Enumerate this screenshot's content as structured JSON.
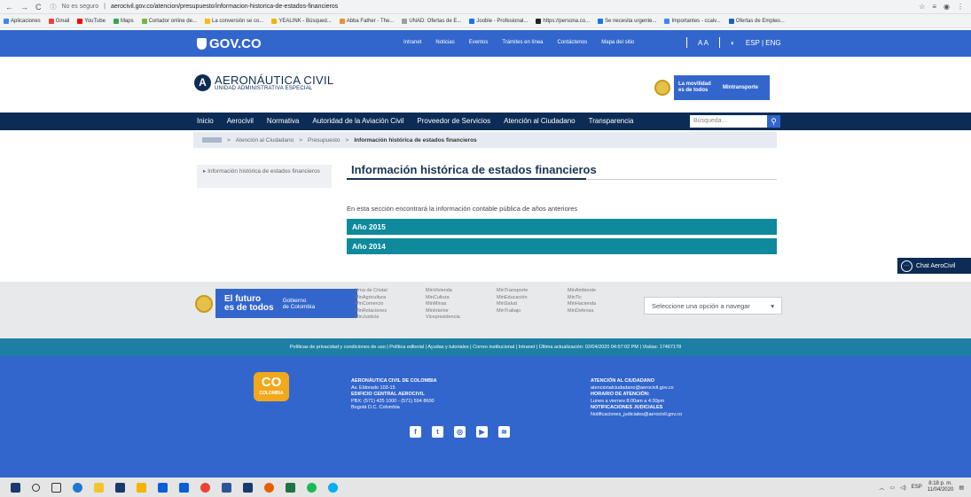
{
  "browser": {
    "security": "No es seguro",
    "url": "aerocivil.gov.co/atencion/presupuesto/informacion-historica-de-estados-financieros",
    "bookmarks": [
      "Aplicaciones",
      "Gmail",
      "YouTube",
      "Maps",
      "Cortador online de...",
      "La conversión se co...",
      "YEALINK - Búsqued...",
      "Abba Father - The...",
      "UNAD: Ofertas de E...",
      "Jooble - Profesional...",
      "https://persona.co...",
      "Se necesita urgente...",
      "Importantes - ccalv...",
      "Ofertas de Empleo..."
    ]
  },
  "gov": {
    "logo": "GOV.CO",
    "menu": [
      "Intranet",
      "Noticias",
      "Eventos",
      "Trámites en línea",
      "Contáctenos",
      "Mapa del sitio"
    ],
    "text_size": "A A",
    "language": "ESP | ENG"
  },
  "header": {
    "title": "AERONÁUTICA CIVIL",
    "subtitle": "UNIDAD ADMINISTRATIVA ESPECIAL",
    "movilidad": "La movilidad es de todos",
    "mintransporte": "Mintransporte"
  },
  "nav": {
    "items": [
      "Inicio",
      "Aerocivil",
      "Normativa",
      "Autoridad de la Aviación Civil",
      "Proveedor de Servicios",
      "Atención al Ciudadano",
      "Transparencia"
    ],
    "search_placeholder": "Búsqueda..."
  },
  "breadcrumb": {
    "items": [
      "Atención al Ciudadano",
      "Presupuesto"
    ],
    "current": "Información histórica de estados financieros"
  },
  "sidebar": {
    "item": "Información histórica de estados financieros"
  },
  "main": {
    "title": "Información histórica de estados financieros",
    "intro": "En esta sección encontrará la información contable pública de años anteriores",
    "years": [
      "Año 2015",
      "Año 2014"
    ]
  },
  "chat": {
    "label": "Chat AeroCivil"
  },
  "footer": {
    "futuro_line1": "El futuro",
    "futuro_line2": "es de todos",
    "gobierno_line1": "Gobierno",
    "gobierno_line2": "de Colombia",
    "links": [
      [
        "Urna de Cristal",
        "MinAgricultura",
        "MinComercio",
        "MinRelaciones",
        "MinJusticia"
      ],
      [
        "MinVivienda",
        "MinCultura",
        "MinMinas",
        "MinInterior",
        "Vicepresidencia"
      ],
      [
        "MinTransporte",
        "MinEducación",
        "MinSalud",
        "MinTrabajo"
      ],
      [
        "MinAmbiente",
        "MinTic",
        "MinHacienda",
        "MinDefensa"
      ]
    ],
    "select_label": "Seleccione una opción a navegar",
    "policy": "Políticas de privacidad y condiciones de uso  |  Política editorial  |  Ayudas y tutoriales  |  Correo institucional  |  Intranet  |  Última actualización: 02/04/2020 04:57:02 PM  |  Visitas: 17467178",
    "co_logo": "CO",
    "co_sub": "COLOMBIA",
    "org": [
      "AERONÁUTICA CIVIL DE COLOMBIA",
      "Av. Eldorado 103-15",
      "EDIFICIO CENTRAL AEROCIVIL",
      "PBX: (571) 425 1000 - (571) 594 8600",
      "Bogotá D.C. Colombia"
    ],
    "atencion": [
      "ATENCIÓN AL CIUDADANO",
      "atencionalciudadano@aerocivil.gov.co",
      "HORARIO DE ATENCIÓN:",
      "Lunes a viernes 8:00am a 4:30pm",
      "NOTIFICACIONES JUDICIALES",
      "Notificaciones_judiciales@aerocivil.gov.co"
    ]
  },
  "taskbar": {
    "lang": "ESP",
    "time": "8:18 p. m.",
    "date": "11/04/2020"
  }
}
